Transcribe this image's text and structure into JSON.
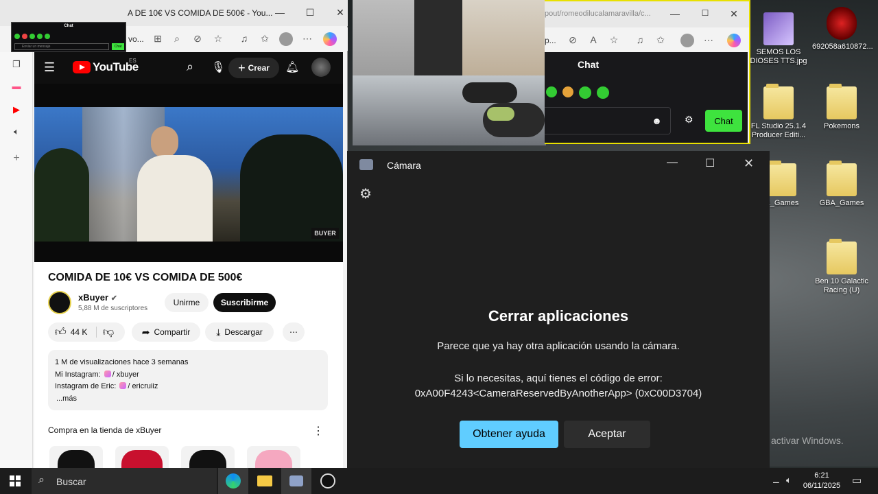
{
  "left_browser": {
    "tab_title": "A DE 10€ VS COMIDA DE 500€ - You...",
    "address_fragment": "vo..."
  },
  "youtube": {
    "logo_text": "YouTube",
    "region": "ES",
    "create_label": "Crear",
    "video_watermark": "BUYER",
    "video_title": "COMIDA DE 10€ VS COMIDA DE 500€",
    "channel_name": "xBuyer",
    "subscribers": "5,88 M de suscriptores",
    "join_label": "Unirme",
    "subscribe_label": "Suscribirme",
    "likes": "44 K",
    "share_label": "Compartir",
    "download_label": "Descargar",
    "desc_views": "1 M de visualizaciones  hace 3 semanas",
    "desc_line1_prefix": "Mi Instagram:",
    "desc_line1_handle": "/ xbuyer",
    "desc_line2_prefix": "Instagram de Eric:",
    "desc_line2_handle": "/ ericruiiz",
    "desc_more": "...más",
    "shop_title": "Compra en la tienda de xBuyer"
  },
  "mini_overlay": {
    "title": "Chat",
    "input_placeholder": "Enviar un mensaje",
    "send_label": "Chat"
  },
  "right_browser": {
    "url_fragment": "pout/romeodilucalamaravilla/c...",
    "p_fragment": "p...",
    "chat_title": "Chat",
    "chat_button": "Chat"
  },
  "desktop_icons": [
    {
      "label": "SEMOS LOS DIOSES TTS.jpg"
    },
    {
      "label": "692058a610872..."
    },
    {
      "label": "FL Studio 25.1.4 Producer Editi..."
    },
    {
      "label": "Pokemons"
    },
    {
      "label": "ta_Games"
    },
    {
      "label": "GBA_Games"
    },
    {
      "label": "Ben 10 Galactic Racing (U)"
    }
  ],
  "watermark_text": "activar Windows.",
  "camera_app": {
    "title": "Cámara",
    "dialog_title": "Cerrar aplicaciones",
    "dialog_line1": "Parece que ya hay otra aplicación usando la cámara.",
    "dialog_line2": "Si lo necesitas, aquí tienes el código de error:",
    "dialog_line3": "0xA00F4243<CameraReservedByAnotherApp> (0xC00D3704)",
    "help_button": "Obtener ayuda",
    "accept_button": "Aceptar",
    "accent_color": "#60cdff"
  },
  "taskbar": {
    "search_placeholder": "Buscar",
    "time": "6:21",
    "date": "06/11/2025"
  }
}
